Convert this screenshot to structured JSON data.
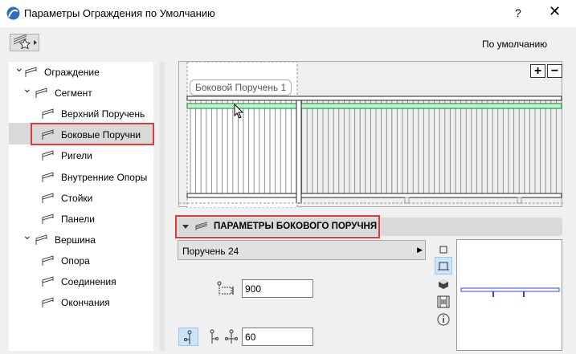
{
  "window": {
    "title": "Параметры Ограждения по Умолчанию",
    "help": "?",
    "close": "✕"
  },
  "toolbar": {
    "default_label": "По умолчанию"
  },
  "tree": {
    "items": [
      {
        "label": "Ограждение"
      },
      {
        "label": "Сегмент"
      },
      {
        "label": "Верхний Поручень"
      },
      {
        "label": "Боковые Поручни"
      },
      {
        "label": "Ригели"
      },
      {
        "label": "Внутренние Опоры"
      },
      {
        "label": "Стойки"
      },
      {
        "label": "Панели"
      },
      {
        "label": "Вершина"
      },
      {
        "label": "Опора"
      },
      {
        "label": "Соединения"
      },
      {
        "label": "Окончания"
      }
    ],
    "selected": "Боковые Поручни"
  },
  "preview": {
    "tooltip": "Боковой Поручень 1",
    "zoom_in": "+",
    "zoom_out": "−"
  },
  "section": {
    "title": "ПАРАМЕТРЫ БОКОВОГО ПОРУЧНЯ",
    "profile": "Поручень 24",
    "height": "900",
    "offset": "60"
  },
  "colors": {
    "highlight": "#e53935",
    "selected_rail": "#b9f6ca",
    "accent": "#cce4f7"
  }
}
